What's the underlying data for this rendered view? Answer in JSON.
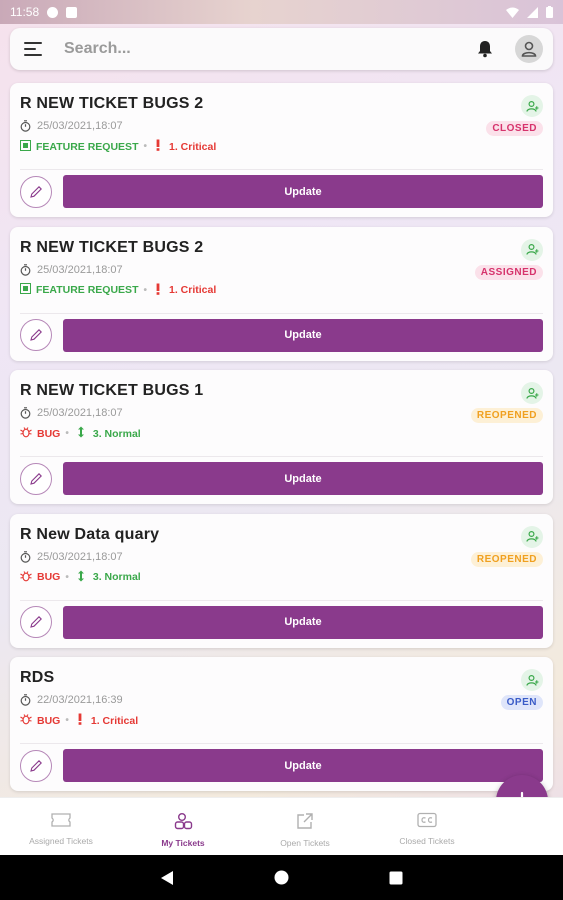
{
  "status_bar": {
    "time": "11:58"
  },
  "search": {
    "placeholder": "Search..."
  },
  "tickets": [
    {
      "title": "R NEW TICKET BUGS 2",
      "datetime": "25/03/2021,18:07",
      "status": "CLOSED",
      "status_color": "#d6336c",
      "status_bg": "#fbe1ea",
      "type": "FEATURE REQUEST",
      "type_icon": "feature-request-icon",
      "type_color": "#3aa84a",
      "priority": "1. Critical",
      "priority_icon": "exclamation-icon",
      "priority_color": "#e53935",
      "update_label": "Update"
    },
    {
      "title": "R NEW TICKET BUGS 2",
      "datetime": "25/03/2021,18:07",
      "status": "ASSIGNED",
      "status_color": "#d6336c",
      "status_bg": "#fbe1ea",
      "type": "FEATURE REQUEST",
      "type_icon": "feature-request-icon",
      "type_color": "#3aa84a",
      "priority": "1. Critical",
      "priority_icon": "exclamation-icon",
      "priority_color": "#e53935",
      "update_label": "Update"
    },
    {
      "title": "R NEW TICKET BUGS 1",
      "datetime": "25/03/2021,18:07",
      "status": "REOPENED",
      "status_color": "#f0a020",
      "status_bg": "#fdf0d6",
      "type": "BUG",
      "type_icon": "bug-icon",
      "type_color": "#e53935",
      "priority": "3. Normal",
      "priority_icon": "up-down-arrow-icon",
      "priority_color": "#3aa84a",
      "update_label": "Update"
    },
    {
      "title": "R New Data quary",
      "datetime": "25/03/2021,18:07",
      "status": "REOPENED",
      "status_color": "#f0a020",
      "status_bg": "#fdf0d6",
      "type": "BUG",
      "type_icon": "bug-icon",
      "type_color": "#e53935",
      "priority": "3. Normal",
      "priority_icon": "up-down-arrow-icon",
      "priority_color": "#3aa84a",
      "update_label": "Update"
    },
    {
      "title": "RDS",
      "datetime": "22/03/2021,16:39",
      "status": "OPEN",
      "status_color": "#3a5bc7",
      "status_bg": "#dfe5fa",
      "type": "BUG",
      "type_icon": "bug-icon",
      "type_color": "#e53935",
      "priority": "1. Critical",
      "priority_icon": "exclamation-icon",
      "priority_color": "#e53935",
      "update_label": "Update"
    }
  ],
  "bottom_nav": [
    {
      "label": "Assigned Tickets",
      "icon": "ticket-icon",
      "active": false
    },
    {
      "label": "My Tickets",
      "icon": "users-icon",
      "active": true
    },
    {
      "label": "Open Tickets",
      "icon": "external-link-icon",
      "active": false
    },
    {
      "label": "Closed Tickets",
      "icon": "closed-caption-icon",
      "active": false
    }
  ],
  "colors": {
    "accent": "#8a3a8c"
  }
}
